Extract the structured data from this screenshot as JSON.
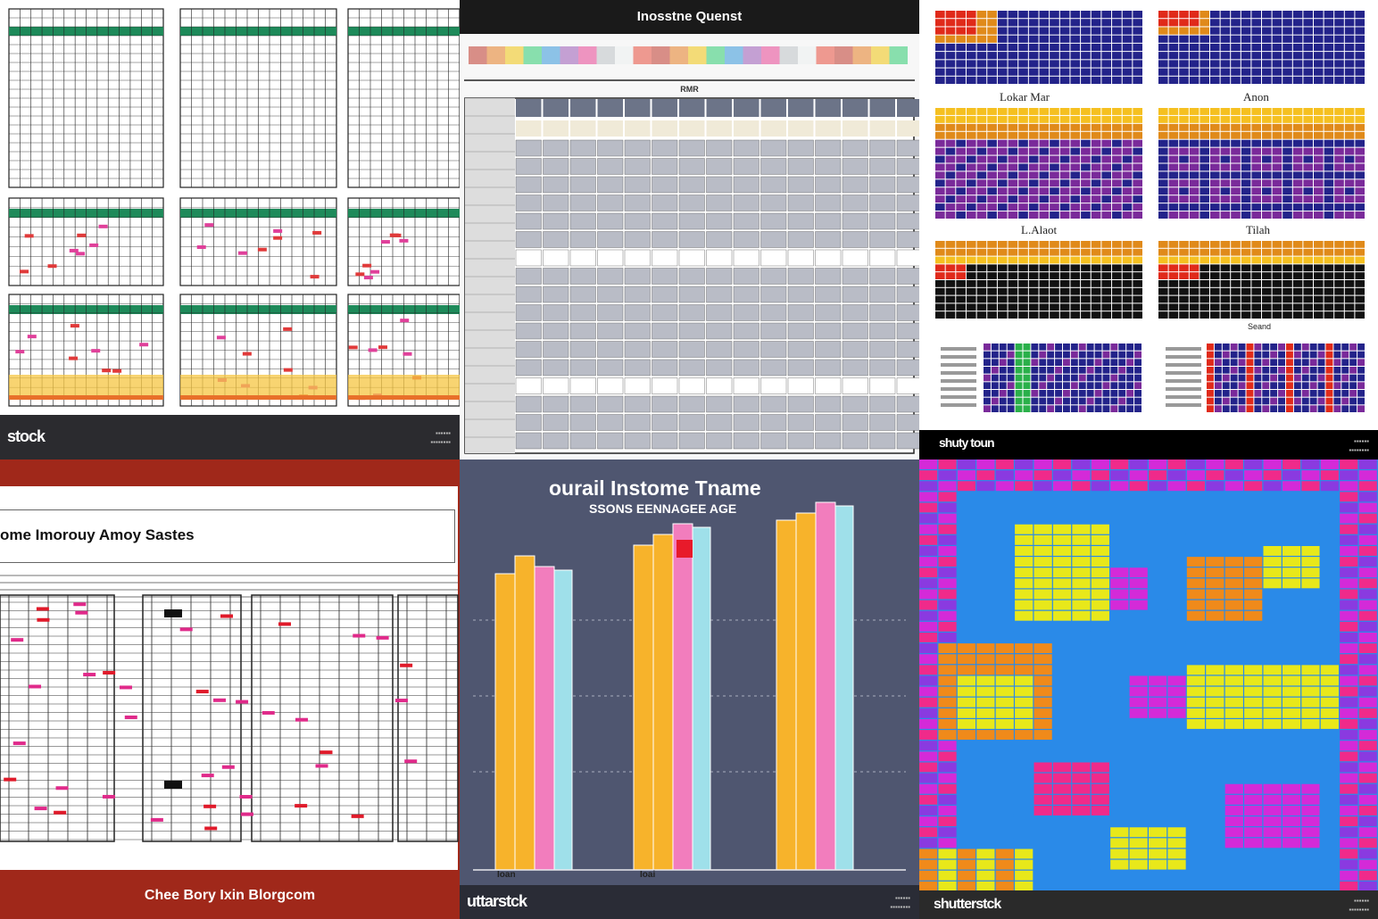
{
  "panels": {
    "p1": {
      "watermark": "stock",
      "colors": {
        "header": "#1e8a5a",
        "grid": "#222222",
        "bg": "#ffffff",
        "accent_yellow": "#f5c542",
        "accent_red": "#e03a3a",
        "accent_pink": "#e0409a"
      }
    },
    "p2": {
      "title": "Inosstne Quenst",
      "subtitle": "RMR",
      "colors": {
        "bg": "#ffffff",
        "grid_header": "#6c7488",
        "cell": "#b9bcc6",
        "cell_light": "#f0ead8"
      }
    },
    "p3": {
      "labels": [
        "Lokar Mar",
        "Anon",
        "L.Alaot",
        "Tilah",
        "",
        "Seand"
      ],
      "watermark": "shuty toun",
      "colors": {
        "bg": "#ffffff",
        "navy": "#23238a",
        "purple": "#7a2a9a",
        "orange": "#e08a1a",
        "red": "#e02a1a",
        "yellow": "#f5c020",
        "green": "#2ab04a"
      }
    },
    "p4": {
      "title": "ome Imorouy Amoy Sastes",
      "caption": "Chee Bory Ixin Blorgcom",
      "colors": {
        "frame": "#a0281a",
        "bg": "#ffffff",
        "grid": "#222222",
        "accent_red": "#e01a2a",
        "accent_pink": "#e02a8a"
      }
    },
    "p5": {
      "title": "ourail Instome Tname",
      "subtitle": "SSONS EENNAGEE AGE",
      "watermark": "uttarstck",
      "bar_labels": [
        "Ioan",
        "Ioai"
      ],
      "colors": {
        "bg": "#4f5670",
        "orange": "#f7b32b",
        "pink": "#f27dbd",
        "cyan": "#9fe0ea",
        "red": "#e81a2a"
      },
      "chart_data": {
        "type": "bar",
        "categories": [
          "Ioan",
          "Ioai",
          ""
        ],
        "series": [
          {
            "values": [
              0.83,
              0.91,
              0.98
            ]
          },
          {
            "values": [
              0.88,
              0.94,
              1.0
            ]
          },
          {
            "values": [
              0.85,
              0.97,
              1.03
            ]
          },
          {
            "values": [
              0.84,
              0.96,
              1.02
            ]
          }
        ]
      }
    },
    "p6": {
      "watermark": "shutterstck",
      "colors": {
        "blue": "#2a8ae8",
        "magenta": "#d42ad8",
        "yellow": "#e8e81a",
        "orange": "#f08a1a",
        "pink": "#f02a8a",
        "purple": "#8a3ae0"
      }
    }
  }
}
